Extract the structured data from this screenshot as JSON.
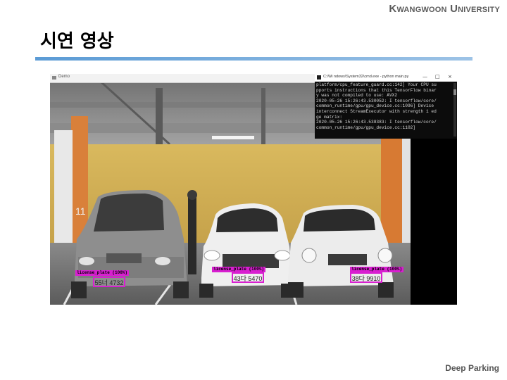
{
  "header": {
    "university_first_initial": "K",
    "university_first_rest": "WANGWOON",
    "university_second_initial": "U",
    "university_second_rest": "NIVERSITY",
    "slide_title": "시연 영상"
  },
  "demo_window": {
    "title": "Demo"
  },
  "console_window": {
    "title": "C:\\Wi  ndows\\System32\\cmd.exe  - python  main.py",
    "minimize": "—",
    "maximize": "□",
    "close": "×",
    "lines": [
      "platform/cpu_feature_guard.cc:142] Your CPU su",
      "pports instructions that this TensorFlow binar",
      "y was not compiled to use: AVX2",
      "2020-05-26 15:26:43.530052: I tensorflow/core/",
      "common_runtime/gpu/gpu_device.cc:1096] Device",
      "interconnect StreamExecutor with strength 1 ed",
      "ge matrix:",
      "2020-05-26 15:26:43.538383: I tensorflow/core/",
      "common_runtime/gpu/gpu_device.cc:1102]"
    ]
  },
  "detections": [
    {
      "label": "license_plate (100%)",
      "plate": "55너 4732"
    },
    {
      "label": "license_plate (100%)",
      "plate": "43다 5470"
    },
    {
      "label": "license_plate (100%)",
      "plate": "38다 9910"
    }
  ],
  "colors": {
    "accent_rule_start": "#5b9bd5",
    "accent_rule_end": "#9dc3e6",
    "detection_magenta": "#d81fd0"
  },
  "footer": {
    "label": "Deep Parking"
  }
}
